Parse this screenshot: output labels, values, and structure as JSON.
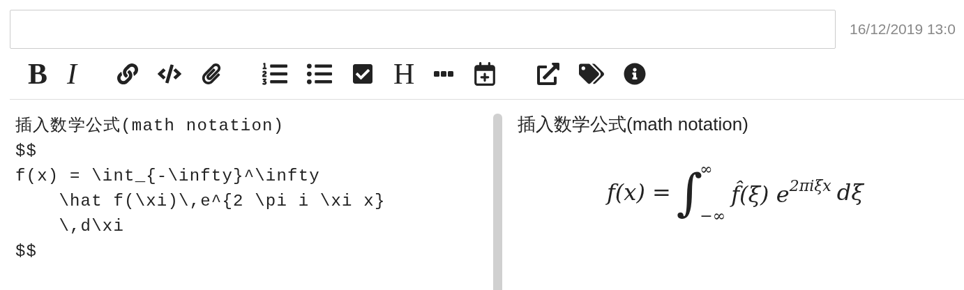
{
  "date": "16/12/2019 13:0",
  "toolbar": [
    {
      "kind": "bold",
      "label": "B"
    },
    {
      "kind": "italic",
      "label": "I"
    },
    {
      "kind": "gap"
    },
    {
      "kind": "icon"
    },
    {
      "kind": "icon"
    },
    {
      "kind": "icon"
    },
    {
      "kind": "gap"
    },
    {
      "kind": "icon"
    },
    {
      "kind": "icon"
    },
    {
      "kind": "icon"
    },
    {
      "kind": "heading",
      "label": "H"
    },
    {
      "kind": "icon"
    },
    {
      "kind": "icon"
    },
    {
      "kind": "gap"
    },
    {
      "kind": "icon"
    },
    {
      "kind": "icon"
    },
    {
      "kind": "icon"
    }
  ],
  "editor": {
    "lines": [
      "插入数学公式(math notation)",
      "$$",
      "f(x) = \\int_{-\\infty}^\\infty",
      "    \\hat f(\\xi)\\,e^{2 \\pi i \\xi x}",
      "    \\,d\\xi",
      "$$"
    ]
  },
  "preview": {
    "heading": "插入数学公式(math notation)",
    "formula": {
      "lhs": "f(x) =",
      "integral": "∫",
      "upper": "∞",
      "lower": "−∞",
      "body": "f̂(ξ) e",
      "exponent": "2πiξx",
      "tail": "dξ"
    }
  }
}
